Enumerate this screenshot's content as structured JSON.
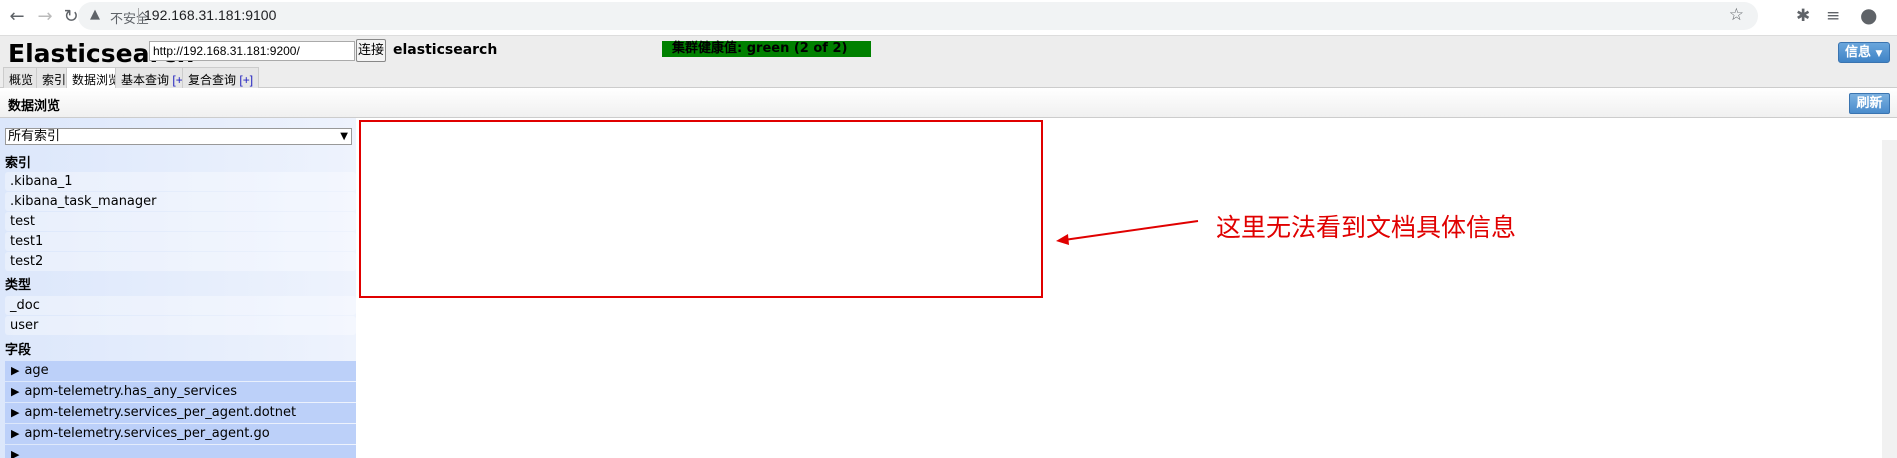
{
  "browser": {
    "security_label": "不安全",
    "url": "192.168.31.181:9100"
  },
  "app": {
    "title": "Elasticsearch",
    "host_value": "http://192.168.31.181:9200/",
    "connect_label": "连接",
    "cluster_name": "elasticsearch",
    "health": "集群健康值: green (2 of 2)",
    "info_label": "信息",
    "health_color": "#008000"
  },
  "tabs": [
    {
      "label": "概览"
    },
    {
      "label": "索引"
    },
    {
      "label": "数据浏览",
      "active": true
    },
    {
      "label": "基本查询",
      "plus": "[+]"
    },
    {
      "label": "复合查询",
      "plus": "[+]"
    }
  ],
  "section": {
    "title": "数据浏览",
    "refresh_label": "刷新"
  },
  "sidebar": {
    "select_value": "所有索引",
    "indices_label": "索引",
    "indices": [
      ".kibana_1",
      ".kibana_task_manager",
      "test",
      "test1",
      "test2"
    ],
    "types_label": "类型",
    "types": [
      "_doc",
      "user"
    ],
    "fields_label": "字段",
    "fields": [
      "age",
      "apm-telemetry.has_any_services",
      "apm-telemetry.services_per_agent.dotnet",
      "apm-telemetry.services_per_agent.go"
    ]
  },
  "annotation": {
    "text": "这里无法看到文档具体信息",
    "color": "#e00000"
  }
}
